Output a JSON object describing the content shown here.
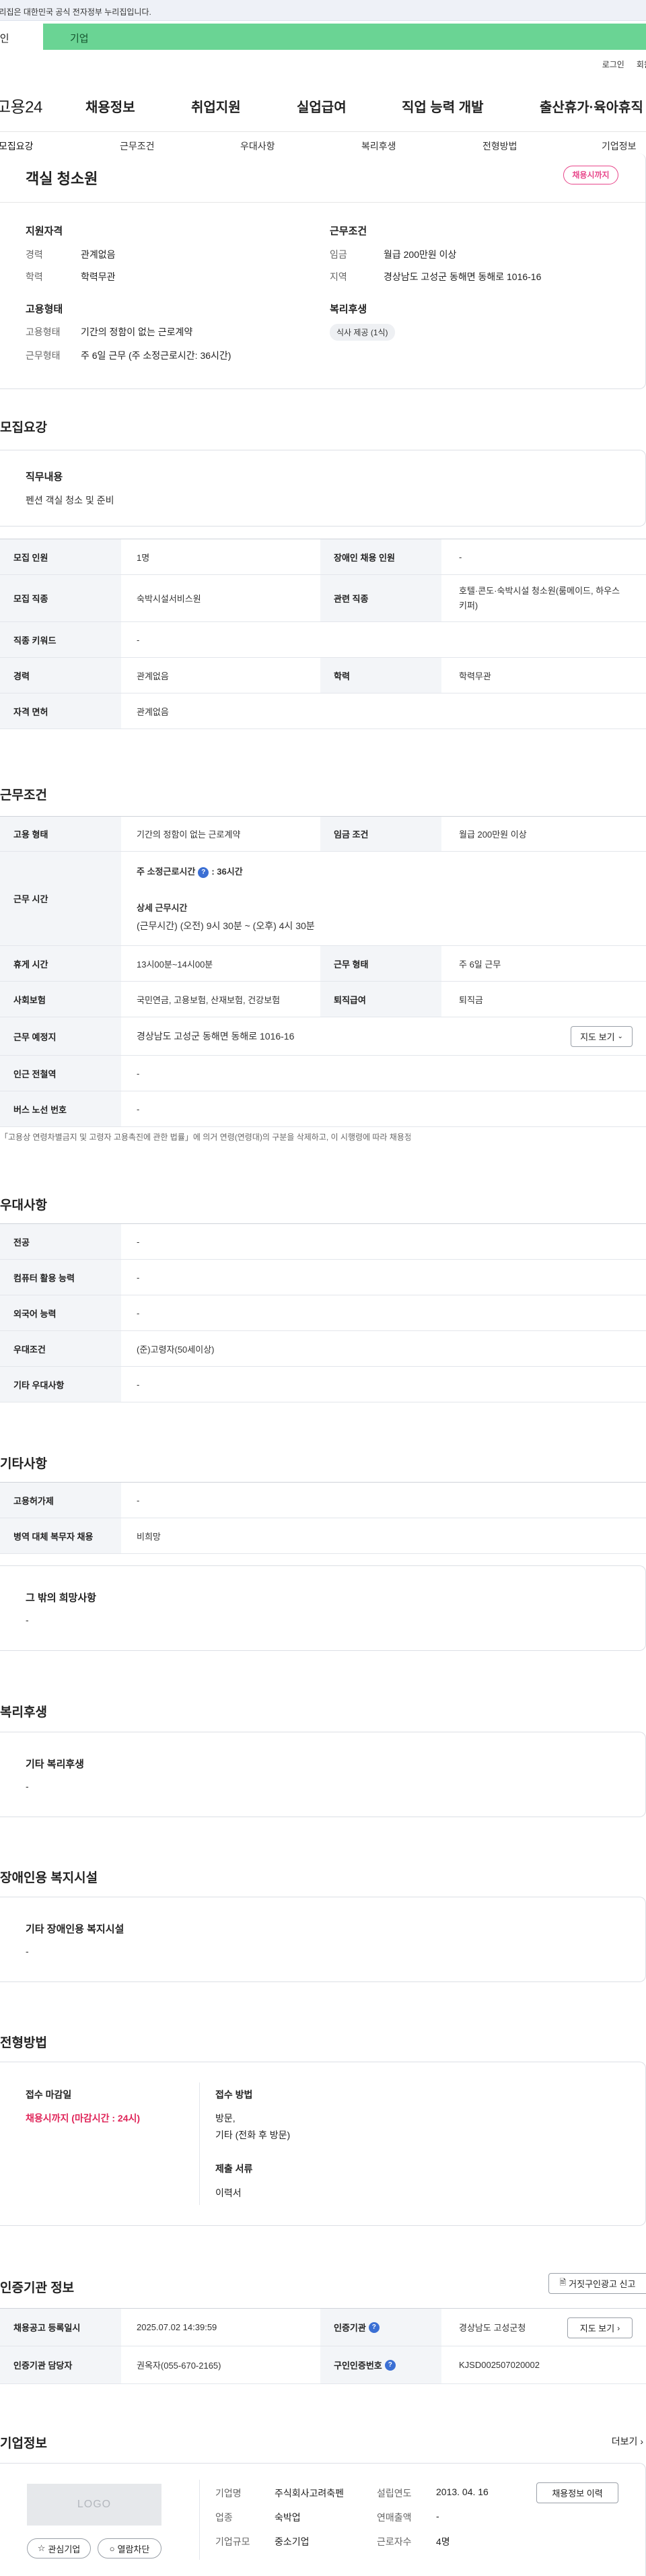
{
  "gov_banner": "이 누리집은 대한민국 공식 전자정부 누리집입니다.",
  "user_tabs": {
    "individual": "개인",
    "company": "기업"
  },
  "util": {
    "login": "로그인",
    "join": "회원가입"
  },
  "gnb": {
    "logo": "고용24",
    "items": [
      "채용정보",
      "취업지원",
      "실업급여",
      "직업 능력 개발",
      "출산휴가·육아휴직"
    ]
  },
  "subnav": [
    "모집요강",
    "근무조건",
    "우대사항",
    "복리후생",
    "전형방법",
    "기업정보"
  ],
  "job": {
    "title": "객실 청소원",
    "badge": "채용시까지",
    "qual_title": "지원자격",
    "qual": [
      {
        "k": "경력",
        "v": "관계없음"
      },
      {
        "k": "학력",
        "v": "학력무관"
      }
    ],
    "cond_title": "근무조건",
    "cond": [
      {
        "k": "임금",
        "v": "월급 200만원 이상"
      },
      {
        "k": "지역",
        "v": "경상남도 고성군 동해면 동해로 1016-16"
      }
    ],
    "emp_title": "고용형태",
    "emp": [
      {
        "k": "고용형태",
        "v": "기간의 정함이 없는 근로계약"
      },
      {
        "k": "근무형태",
        "v": "주 6일 근무 (주 소정근로시간: 36시간)"
      }
    ],
    "welfare_title": "복리후생",
    "welfare_chip": "식사 제공 (1식)"
  },
  "recruit": {
    "title": "모집요강",
    "duty_h": "직무내용",
    "duty_v": "펜션 객실 청소 및 준비",
    "rows": {
      "count_h": "모집 인원",
      "count_v": "1명",
      "disabled_h": "장애인 채용 인원",
      "disabled_v": "-",
      "job_h": "모집 직종",
      "job_v": "숙박시설서비스원",
      "related_h": "관련 직종",
      "related_v1": "호텔·콘도·숙박시설 청소원(룸메이드, 하우스",
      "related_v2": "키퍼)",
      "kw_h": "직종 키워드",
      "kw_v": "-",
      "career_h": "경력",
      "career_v": "관계없음",
      "edu_h": "학력",
      "edu_v": "학력무관",
      "license_h": "자격 면허",
      "license_v": "관계없음"
    }
  },
  "work": {
    "title": "근무조건",
    "emp_h": "고용 형태",
    "emp_v": "기간의 정함이 없는 근로계약",
    "wage_h": "임금 조건",
    "wage_v": "월급 200만원 이상",
    "time_h": "근무 시간",
    "time_v1_a": "주 소정근로시간",
    "time_v1_b": ": 36시간",
    "time_v2": "상세 근무시간",
    "time_v3": "(근무시간) (오전) 9시 30분 ~ (오후) 4시 30분",
    "rest_h": "휴게 시간",
    "rest_v": "13시00분~14시00분",
    "form_h": "근무 형태",
    "form_v": "주 6일 근무",
    "ins_h": "사회보험",
    "ins_v": "국민연금, 고용보험, 산재보험, 건강보험",
    "sev_h": "퇴직급여",
    "sev_v": "퇴직금",
    "place_h": "근무 예정지",
    "place_v": "경상남도 고성군 동해면 동해로 1016-16",
    "map_btn": "지도 보기",
    "subway_h": "인근 전철역",
    "subway_v": "-",
    "bus_h": "버스 노선 번호",
    "bus_v": "-",
    "note": "「고용상 연령차별금지 및 고령자 고용촉진에 관한 법률」에 의거 연령(연령대)의 구분을 삭제하고, 이 시행령에 따라 채용정보에서 연령이 삭제되었습니다."
  },
  "pref": {
    "title": "우대사항",
    "rows": [
      {
        "h": "전공",
        "v": "-"
      },
      {
        "h": "컴퓨터 활용 능력",
        "v": "-"
      },
      {
        "h": "외국어 능력",
        "v": "-"
      },
      {
        "h": "우대조건",
        "v": "(준)고령자(50세이상)"
      },
      {
        "h": "기타 우대사항",
        "v": "-"
      }
    ]
  },
  "etc": {
    "title": "기타사항",
    "rows": [
      {
        "h": "고용허가제",
        "v": "-"
      },
      {
        "h": "병역 대체 복무자 채용",
        "v": "비희망"
      }
    ],
    "other_h": "그 밖의 희망사항",
    "other_v": "-"
  },
  "welfare": {
    "title": "복리후생",
    "h": "기타 복리후생",
    "v": "-"
  },
  "disabled": {
    "title": "장애인용 복지시설",
    "h": "기타 장애인용 복지시설",
    "v": "-"
  },
  "selection": {
    "title": "전형방법",
    "deadline_h": "접수 마감일",
    "deadline_v": "채용시까지 (마감시간 : 24시)",
    "method_h": "접수 방법",
    "method_v1": "방문,",
    "method_v2": "기타 (전화 후 방문)",
    "docs_h": "제출 서류",
    "docs_v": "이력서"
  },
  "cert": {
    "title": "인증기관 정보",
    "report_btn": "거짓구인광고 신고",
    "reg_h": "채용공고 등록일시",
    "reg_v": "2025.07.02 14:39:59",
    "org_h": "인증기관",
    "org_v": "경상남도 고성군청",
    "map_btn": "지도 보기",
    "mgr_h": "인증기관 담당자",
    "mgr_v": "권옥자(055-670-2165)",
    "no_h": "구인인증번호",
    "no_v": "KJSD002507020002"
  },
  "company": {
    "title": "기업정보",
    "more": "더보기",
    "logo": "LOGO",
    "fav_btn": "관심기업",
    "block_btn": "열람차단",
    "name_k": "기업명",
    "name_v": "주식회사고려축펜",
    "ind_k": "업종",
    "ind_v": "숙박업",
    "size_k": "기업규모",
    "size_v": "중소기업",
    "est_k": "설립연도",
    "est_v": "2013. 04. 16",
    "sales_k": "연매출액",
    "sales_v": "-",
    "emp_k": "근로자수",
    "emp_v": "4명",
    "hist_btn": "채용정보 이력"
  }
}
